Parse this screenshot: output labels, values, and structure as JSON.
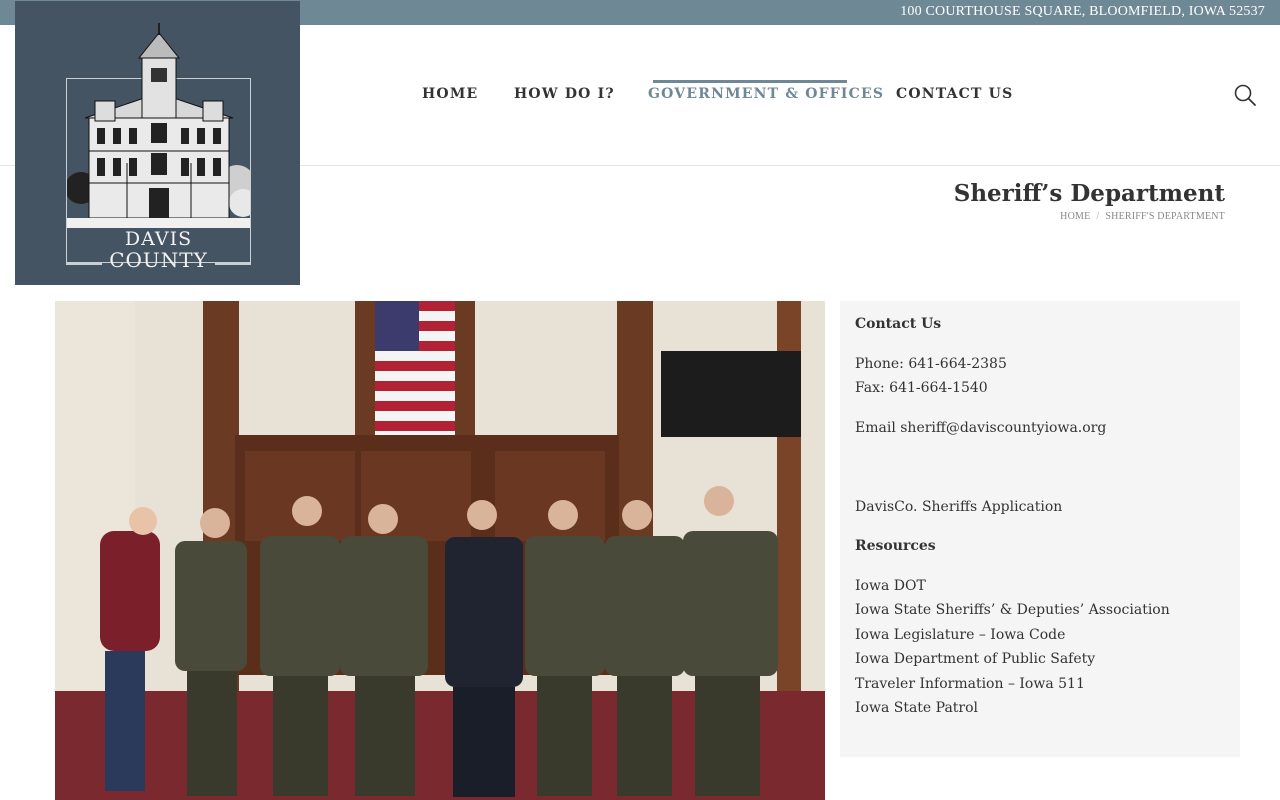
{
  "topbar": {
    "address": "100 COURTHOUSE SQUARE, BLOOMFIELD, IOWA 52537"
  },
  "logo": {
    "line1": "DAVIS",
    "line2": "COUNTY"
  },
  "nav": {
    "items": [
      {
        "label": "HOME"
      },
      {
        "label": "HOW DO I?"
      },
      {
        "label": "GOVERNMENT & OFFICES"
      },
      {
        "label": "CONTACT US"
      }
    ],
    "active_index": 2
  },
  "page": {
    "title": "Sheriff’s Department",
    "breadcrumb": [
      "HOME",
      "SHERIFF'S DEPARTMENT"
    ]
  },
  "sidebar": {
    "contact_heading": "Contact Us",
    "phone": "Phone: 641-664-2385",
    "fax": "Fax: 641-664-1540",
    "email": "Email sheriff@daviscountyiowa.org",
    "application": "DavisCo. Sheriffs Application",
    "resources_heading": "Resources",
    "resources": [
      "Iowa DOT",
      "Iowa State Sheriffs’ & Deputies’ Association",
      "Iowa Legislature – Iowa Code",
      "Iowa Department of Public Safety",
      "Traveler Information – Iowa 511",
      "Iowa State Patrol"
    ]
  },
  "colors": {
    "topbar": "#6f8896",
    "logo_bg": "#445462",
    "accent": "#6f8896",
    "sidebar_bg": "#f5f5f5"
  },
  "icons": {
    "search": "search-icon"
  }
}
